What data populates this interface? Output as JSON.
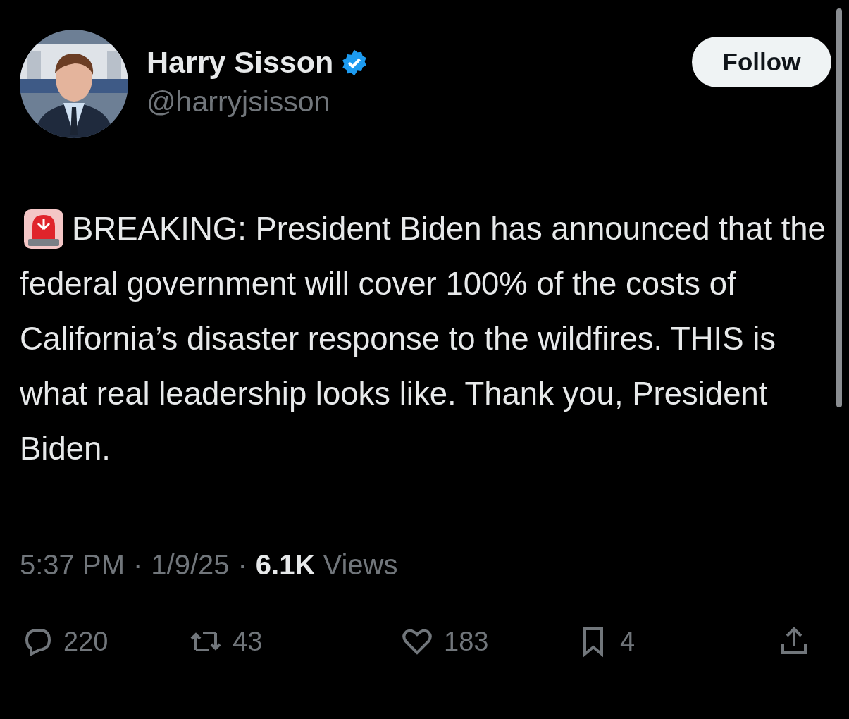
{
  "author": {
    "name": "Harry Sisson",
    "verified": true,
    "handle": "@harryjsisson"
  },
  "follow_button": {
    "label": "Follow"
  },
  "post": {
    "has_emoji": true,
    "text": "BREAKING: President Biden has announced that the federal government will cover 100% of the costs of California’s disaster response to the wildfires. THIS is what real leadership looks like. Thank you, President Biden."
  },
  "meta": {
    "time": "5:37 PM",
    "separator_1": "·",
    "date": "1/9/25",
    "separator_2": "·",
    "views": "**6.1K** Views"
  },
  "actions": [
    {
      "kind": "reply",
      "count": "220"
    },
    {
      "kind": "repost",
      "count": "43"
    },
    {
      "kind": "like",
      "count": "183"
    },
    {
      "kind": "bookmark",
      "count": "4"
    },
    {
      "kind": "share"
    }
  ]
}
